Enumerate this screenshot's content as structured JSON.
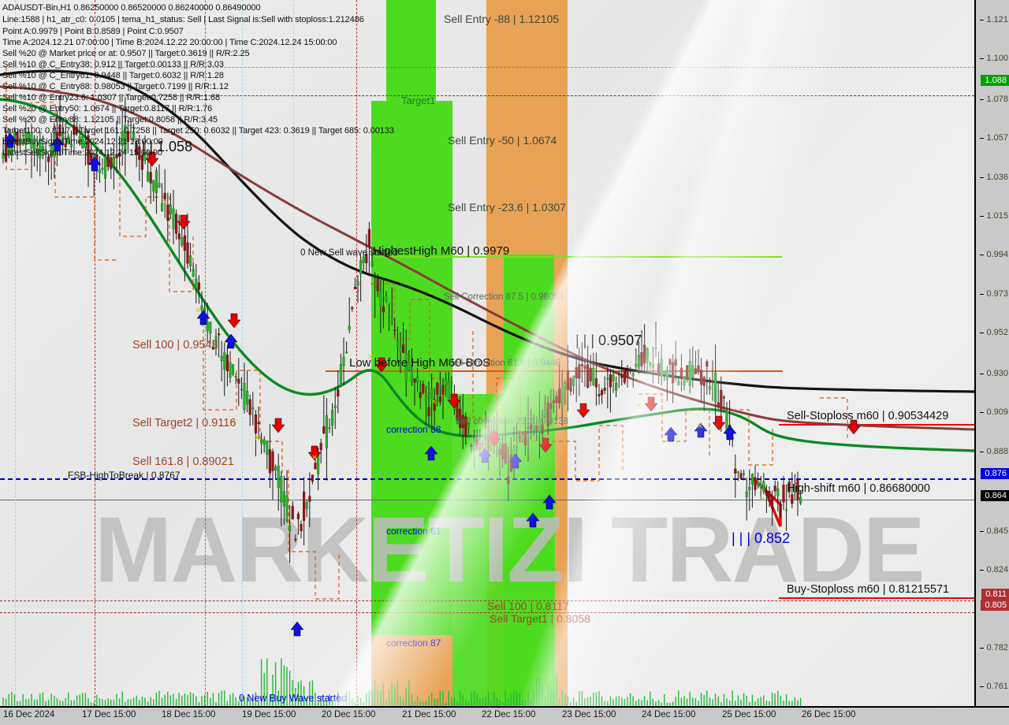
{
  "header": {
    "lines": [
      "ADAUSDT-Bin,H1   0.86250000 0.86520000 0.86240000 0.86490000",
      "Line:1588 | h1_atr_c0: 0.0105 | tema_h1_status: Sell | Last Signal is:Sell with stoploss:1.212486",
      "Point A:0.9979 | Point B:0.8589 | Point C:0.9507",
      "Time A:2024.12.21 07:00:00 | Time B:2024.12.22 20:00:00 | Time C:2024.12.24 15:00:00",
      "Sell %20 @ Market price or at: 0.9507 || Target:0.3619 || R/R:2.25",
      "Sell %10 @ C_Entry38: 0.912 || Target:0.00133 || R/R:3.03",
      "Sell %10 @ C_Entry61: 0.9448 || Target:0.6032 || R/R:1.28",
      "Sell %10 @ C_Entry88: 0.98053 || Target:0.7199 || R/R:1.12",
      "Sell %10 @ Entry23.6: 1.0307 || Target:0.7258 || R/R:1.68",
      "Sell %20 @ Entry50: 1.0674 || Target:0.8117 || R/R:1.76",
      "Sell %20 @ Entry88: 1.12105 || Target:0.8058 || R/R:3.45",
      "Target100: 0.8117 || Target 161: 0.7258 || Target 250: 0.6032 || Target 423: 0.3619 || Target 685: 0.00133",
      "LatestBuySignalTime:2024.12.21 13:00:00",
      "LatestSellSignalTime:2024.12.24 15:00:00"
    ]
  },
  "symbol": "ADAUSDT-Bin",
  "timeframe": "H1",
  "watermark": "MARKETIZI TRADE",
  "chart_data": {
    "type": "line",
    "title": "ADAUSDT-Bin,H1",
    "xlabel": "",
    "ylabel": "",
    "grid": false,
    "ylim": [
      0.7505,
      1.1315
    ],
    "y_ticks": [
      "1.121",
      "1.100",
      "1.078",
      "1.057",
      "1.036",
      "1.015",
      "0.994",
      "0.973",
      "0.952",
      "0.930",
      "0.909",
      "0.888",
      "0.845",
      "0.824",
      "0.782",
      "0.761"
    ],
    "x_ticks": [
      "16 Dec 2024",
      "17 Dec 15:00",
      "18 Dec 15:00",
      "19 Dec 15:00",
      "20 Dec 15:00",
      "21 Dec 15:00",
      "22 Dec 15:00",
      "23 Dec 15:00",
      "24 Dec 15:00",
      "25 Dec 15:00",
      "26 Dec 15:00"
    ],
    "ohlc_current": {
      "open": 0.8625,
      "high": 0.8652,
      "low": 0.8624,
      "close": 0.8649
    },
    "price_tags": [
      {
        "label": "1.088",
        "value": 1.088,
        "color": "#00a000",
        "text_color": "#ffffff"
      },
      {
        "label": "0.876",
        "value": 0.876,
        "color": "#0000ee",
        "text_color": "#ffffff"
      },
      {
        "label": "0.864",
        "value": 0.864,
        "color": "#000000",
        "text_color": "#ffffff"
      },
      {
        "label": "0.811",
        "value": 0.811,
        "color": "#b03030",
        "text_color": "#ffffff"
      },
      {
        "label": "0.805",
        "value": 0.805,
        "color": "#b03030",
        "text_color": "#ffffff"
      }
    ],
    "points": {
      "A": 0.9979,
      "B": 0.8589,
      "C": 0.9507
    },
    "levels": [
      {
        "name": "Sell Entry -88",
        "label": "Sell Entry -88 | 1.12105",
        "value": 1.12105
      },
      {
        "name": "Target1",
        "label": "Target1",
        "value": 1.088
      },
      {
        "name": "Sell Entry -50",
        "label": "Sell Entry -50 | 1.0674",
        "value": 1.0674
      },
      {
        "name": "Sell Entry -23.6",
        "label": "Sell Entry -23.6 | 1.0307",
        "value": 1.0307
      },
      {
        "name": "HighestHigh M60",
        "label": "HighestHigh  M60 | 0.9979",
        "value": 0.9979
      },
      {
        "name": "Sell Correction 87.5",
        "label": "Sell Correction 87.5 | 0.98053",
        "value": 0.98053
      },
      {
        "name": "Sell 100",
        "label": "Sell 100 | 0.9543",
        "value": 0.9543
      },
      {
        "name": "Low before High M60-BOS",
        "label": "Low before High  M60-BOS",
        "value": 0.9384
      },
      {
        "name": "Sell correction 61.8",
        "label": "Sell correction 61.8 | 0.9448",
        "value": 0.9448
      },
      {
        "name": "Sell correction 23.2",
        "label": "Sell correction 23.2 | 0.9138",
        "value": 0.9138
      },
      {
        "name": "Sell Target2",
        "label": "Sell Target2 | 0.9116",
        "value": 0.9116
      },
      {
        "name": "Sell-Stoploss m60",
        "label": "Sell-Stoploss m60 | 0.90534429",
        "value": 0.90534429
      },
      {
        "name": "Sell 161.8",
        "label": "Sell 161.8 | 0.89021",
        "value": 0.89021
      },
      {
        "name": "FSB-HighToBreak",
        "label": "FSB-HighToBreak | 0.8767",
        "value": 0.8767
      },
      {
        "name": "High-shift m60",
        "label": "High-shift m60 | 0.86680000",
        "value": 0.8668
      },
      {
        "name": "Sell 100 lower",
        "label": "Sell 100 | 0.8117",
        "value": 0.8117
      },
      {
        "name": "Sell Target1",
        "label": "Sell Target1 | 0.8058",
        "value": 0.8058
      },
      {
        "name": "Buy-Stoploss m60",
        "label": "Buy-Stoploss m60 | 0.81215571",
        "value": 0.81215571
      }
    ],
    "wave_labels": [
      {
        "text": "| | | 1.058",
        "value": 1.058
      },
      {
        "text": "| | | 0.9507",
        "value": 0.9507
      },
      {
        "text": "| | | 0.852",
        "value": 0.852
      }
    ],
    "zone_labels": [
      {
        "text": "correction 38"
      },
      {
        "text": "correction 61"
      },
      {
        "text": "correction 87"
      }
    ],
    "events": [
      {
        "text": "0 New Sell wave started"
      },
      {
        "text": "0 New Buy Wave started"
      }
    ]
  },
  "annotations": {
    "sell_entry_88": "Sell Entry -88 | 1.12105",
    "target1": "Target1",
    "sell_entry_50": "Sell Entry -50 | 1.0674",
    "sell_entry_236": "Sell Entry -23.6 | 1.0307",
    "highest_high": "HighestHigh  M60 | 0.9979",
    "new_sell_wave": "0 New Sell wave started",
    "sell_corr_875": "Sell Correction 87.5 | 0.98053",
    "wave_1058": "| | | 1.058",
    "wave_09507": "| | | 0.9507",
    "wave_0852": "| | | 0.852",
    "sell_100_high": "Sell 100 | 0.9543",
    "low_before_high": "Low before High  M60-BOS",
    "sell_corr_618": "Sell correction 61.8 | 0.9448",
    "sell_corr_232": "Sell correction 23.2 | 0.9138",
    "sell_target2": "Sell Target2 | 0.9116",
    "sell_stoploss": "Sell-Stoploss m60 | 0.90534429",
    "sell_1618": "Sell 161.8 | 0.89021",
    "fsb_high": "FSB-HighToBreak | 0.8767",
    "high_shift": "High-shift m60 | 0.86680000",
    "buy_stoploss": "Buy-Stoploss m60 | 0.81215571",
    "sell_100_low": "Sell 100 | 0.8117",
    "sell_target1": "Sell Target1 | 0.8058",
    "correction_38": "correction 38",
    "correction_61": "correction 61",
    "correction_87": "correction 87",
    "new_buy_wave": "0 New Buy Wave started"
  },
  "colors": {
    "green_zone": "#4ddb1f",
    "orange_zone": "#e8a255",
    "red_line": "#ee0000",
    "blue_line": "#0000ee",
    "dark_red": "#8b3a3a",
    "green_ma": "#0a8a22",
    "black_ma": "#111111",
    "price_tag_green": "#00a000",
    "price_tag_blue": "#0000ee",
    "price_tag_black": "#000000",
    "price_tag_red": "#b03030",
    "orange_line": "#e05a10",
    "axis_bg": "#c9c9c9"
  }
}
